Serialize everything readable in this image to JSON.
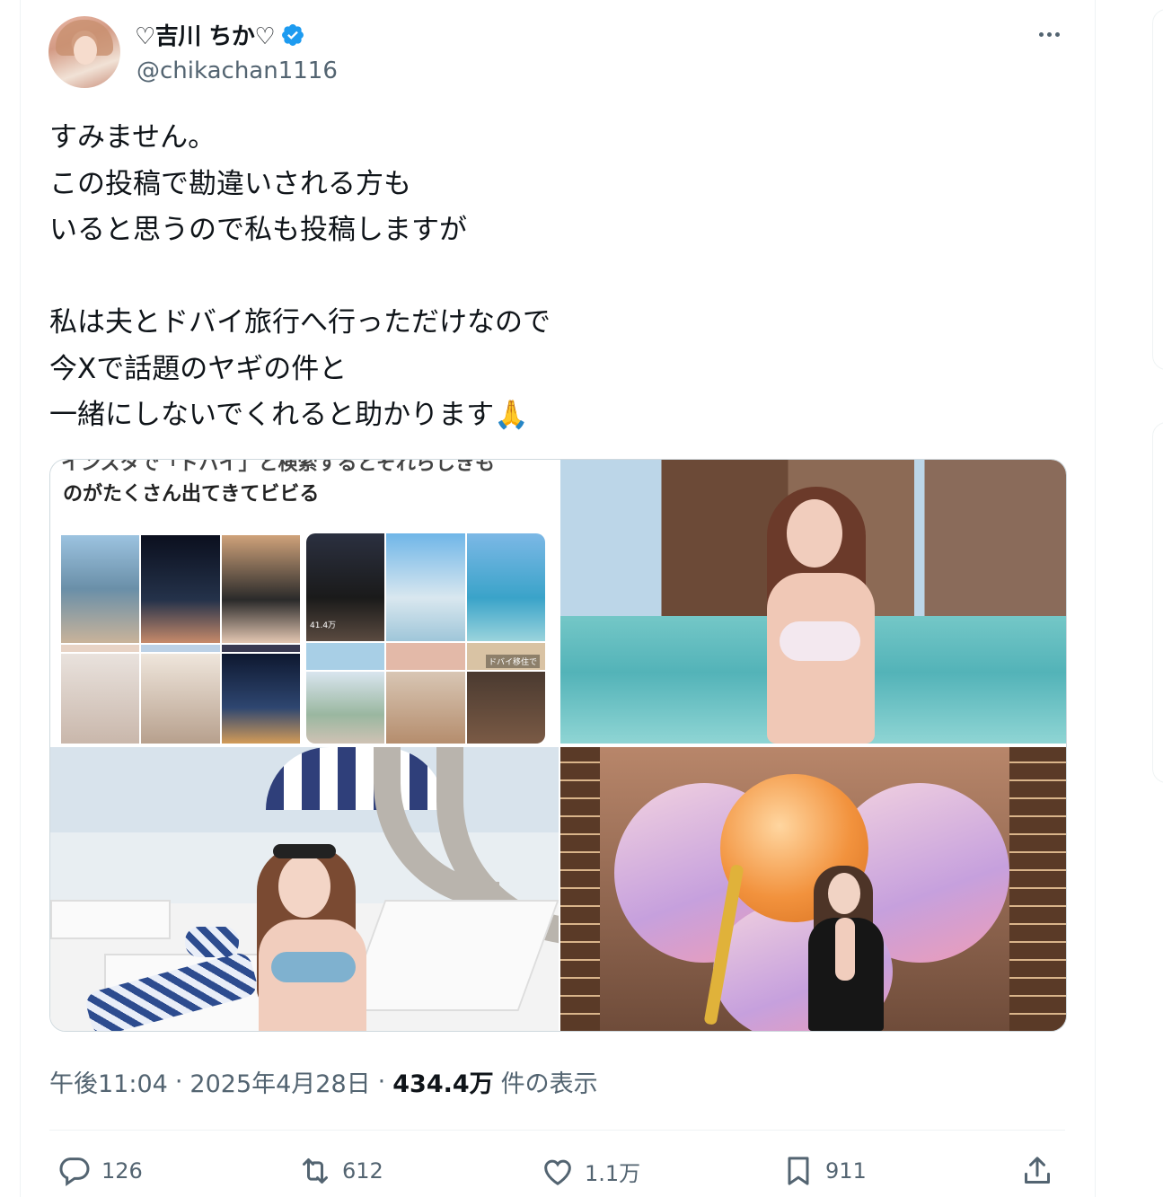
{
  "author": {
    "display_name": "♡吉川 ちか♡",
    "handle": "@chikachan1116",
    "verified": true
  },
  "tweet": {
    "text": "すみません。\nこの投稿で勘違いされる方も\nいると思うので私も投稿しますが\n\n私は夫とドバイ旅行へ行っただけなので\n今Xで話題のヤギの件と\n一緒にしないでくれると助かります🙏"
  },
  "media": {
    "image1": {
      "cut_caption": "インスタで「ドバイ」と検索するとそれらしきも",
      "caption": "のがたくさん出てきてビビる",
      "views_label": "41.4万",
      "dubai_label": "ドバイ移住で"
    }
  },
  "meta": {
    "time": "午後11:04",
    "dot1": "·",
    "date": "2025年4月28日",
    "dot2": "·",
    "views": "434.4万",
    "views_suffix": "件の表示"
  },
  "actions": {
    "reply_count": "126",
    "retweet_count": "612",
    "like_count": "1.1万",
    "bookmark_count": "911"
  },
  "colors": {
    "verified_blue": "#1d9bf0",
    "text_primary": "#0f1419",
    "text_secondary": "#536471",
    "border": "#eff3f4"
  }
}
